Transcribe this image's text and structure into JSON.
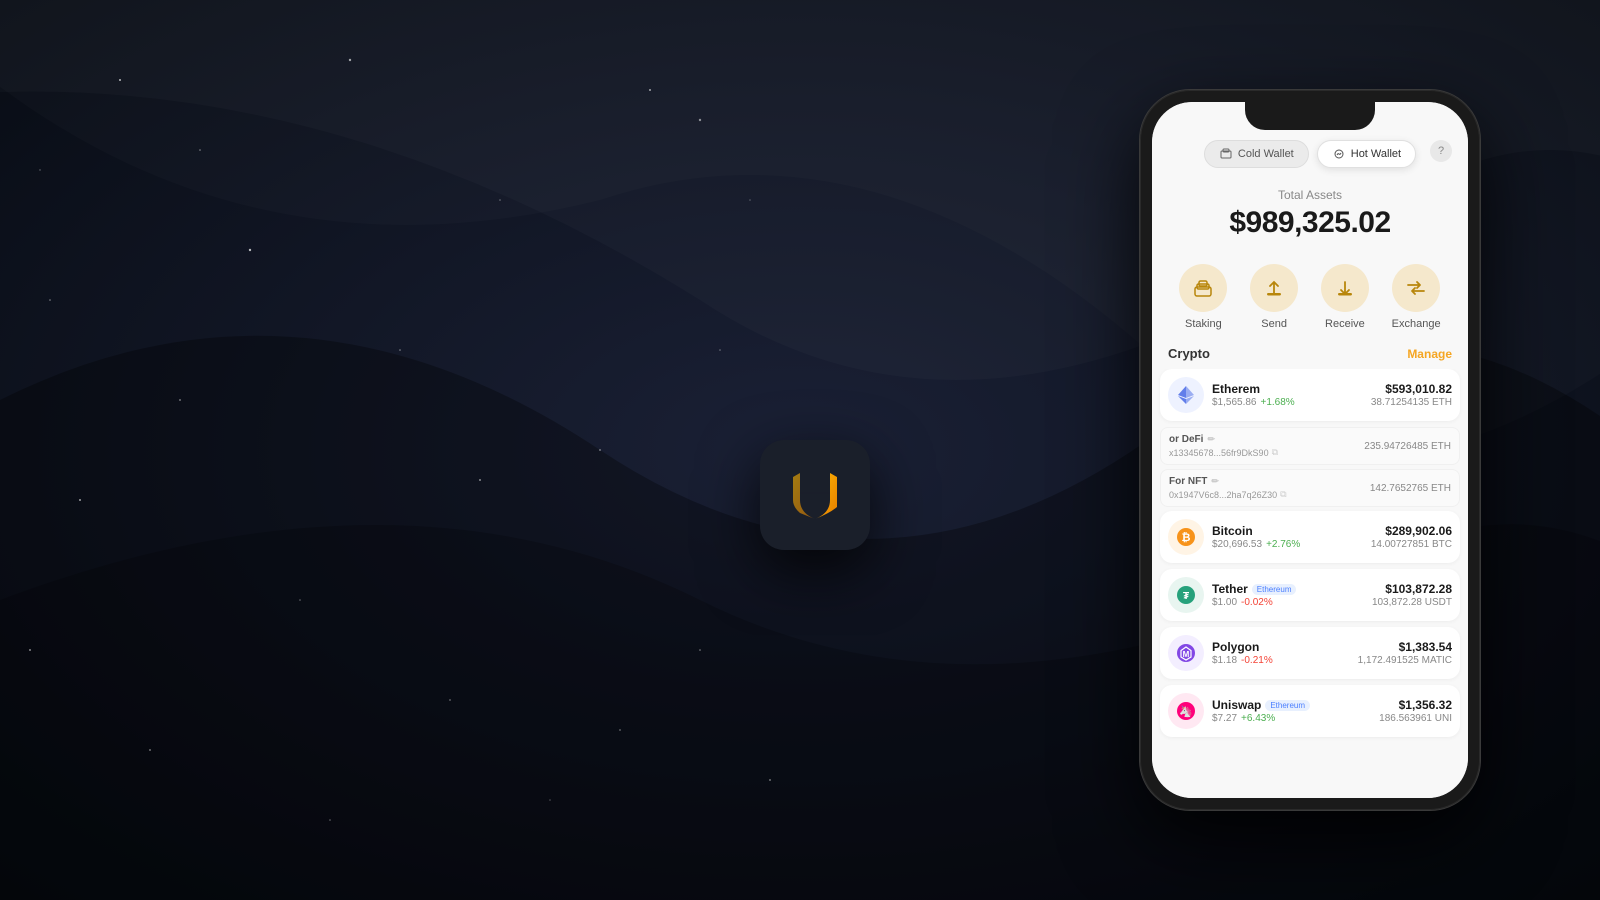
{
  "background": {
    "color": "#0d1118"
  },
  "app_icon": {
    "label": "Crypto Wallet App Icon"
  },
  "phone": {
    "wallet_selector": {
      "cold_wallet_label": "Cold Wallet",
      "hot_wallet_label": "Hot Wallet",
      "help_icon": "?"
    },
    "total_assets": {
      "label": "Total Assets",
      "value": "$989,325.02"
    },
    "actions": [
      {
        "id": "staking",
        "label": "Staking",
        "icon": "🏦"
      },
      {
        "id": "send",
        "label": "Send",
        "icon": "↑"
      },
      {
        "id": "receive",
        "label": "Receive",
        "icon": "↓"
      },
      {
        "id": "exchange",
        "label": "Exchange",
        "icon": "⇄"
      }
    ],
    "crypto_section": {
      "title": "Crypto",
      "manage_label": "Manage"
    },
    "crypto_list": [
      {
        "id": "ethereum",
        "name": "Etherem",
        "price": "$1,565.86",
        "change": "+1.68%",
        "change_type": "positive",
        "usd_value": "$593,010.82",
        "amount": "38.71254135 ETH",
        "icon_color": "#627EEA",
        "sub_items": [
          {
            "label": "or DeFi",
            "address": "x13345678...56fr9DkS90",
            "eth_amount": "235.94726485 ETH"
          },
          {
            "label": "For NFT",
            "address": "0x1947V6c8...2ha7q26Z30",
            "eth_amount": "142.7652765 ETH"
          }
        ]
      },
      {
        "id": "bitcoin",
        "name": "Bitcoin",
        "price": "$20,696.53",
        "change": "+2.76%",
        "change_type": "positive",
        "usd_value": "$289,902.06",
        "amount": "14.00727851 BTC",
        "icon_color": "#F7931A"
      },
      {
        "id": "tether",
        "name": "Tether",
        "badge": "Ethereum",
        "price": "$1.00",
        "change": "-0.02%",
        "change_type": "negative",
        "usd_value": "$103,872.28",
        "amount": "103,872.28 USDT",
        "icon_color": "#26A17B"
      },
      {
        "id": "polygon",
        "name": "Polygon",
        "price": "$1.18",
        "change": "-0.21%",
        "change_type": "negative",
        "usd_value": "$1,383.54",
        "amount": "1,172.491525 MATIC",
        "icon_color": "#8247E5"
      },
      {
        "id": "uniswap",
        "name": "Uniswap",
        "badge": "Ethereum",
        "price": "$7.27",
        "change": "+6.43%",
        "change_type": "positive",
        "usd_value": "$1,356.32",
        "amount": "186.563961 UNI",
        "icon_color": "#FF007A"
      }
    ]
  }
}
